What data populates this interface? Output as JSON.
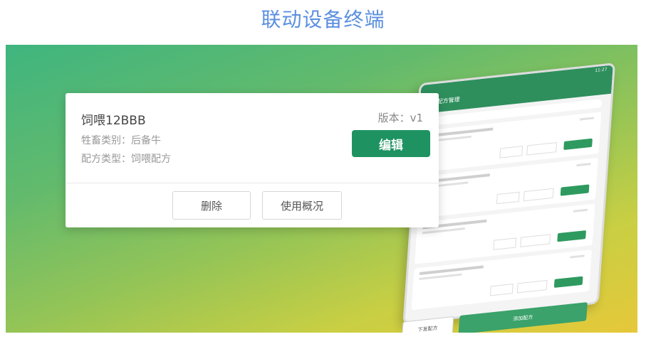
{
  "page": {
    "title": "联动设备终端"
  },
  "card": {
    "name": "饲喂12BBB",
    "version": "版本：v1",
    "livestock_type": "牲畜类别：后备牛",
    "formula_type": "配方类型：饲喂配方",
    "edit_label": "编辑",
    "delete_label": "删除",
    "usage_label": "使用概况"
  },
  "phone": {
    "header_title": "配方管理",
    "status": "11:27",
    "footer_left": "下发配方",
    "footer_right": "添加配方"
  },
  "colors": {
    "accent": "#1e9361",
    "title": "#5b8fe0"
  }
}
